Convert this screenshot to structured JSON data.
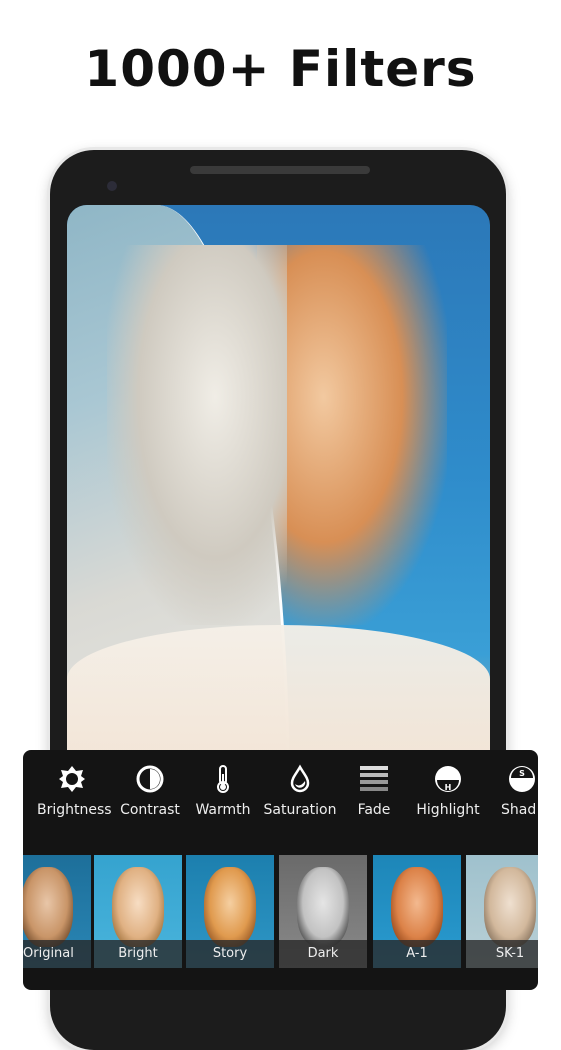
{
  "headline": "1000+ Filters",
  "tools": [
    {
      "label": "Brightness",
      "icon": "sun-icon"
    },
    {
      "label": "Contrast",
      "icon": "contrast-icon"
    },
    {
      "label": "Warmth",
      "icon": "thermometer-icon"
    },
    {
      "label": "Saturation",
      "icon": "drop-icon"
    },
    {
      "label": "Fade",
      "icon": "lines-icon"
    },
    {
      "label": "Highlight",
      "icon": "highlight-icon",
      "glyph": "H"
    },
    {
      "label": "Shad",
      "icon": "shadow-icon",
      "glyph": "S"
    }
  ],
  "filters": [
    {
      "label": "Original"
    },
    {
      "label": "Bright"
    },
    {
      "label": "Story"
    },
    {
      "label": "Dark"
    },
    {
      "label": "A-1"
    },
    {
      "label": "SK-1"
    }
  ]
}
